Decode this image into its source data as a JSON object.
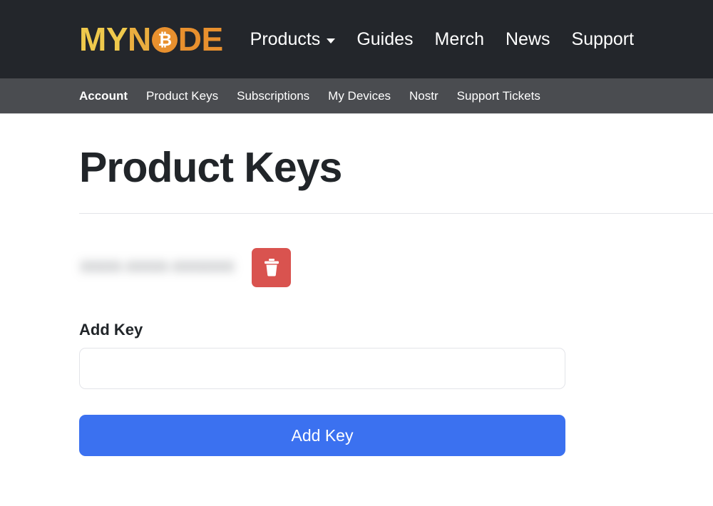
{
  "header": {
    "logo": {
      "part1": "MY",
      "part2": "N",
      "bitcoin_icon": "bitcoin-icon",
      "part3": "DE",
      "colors": {
        "yellow": "#efc94c",
        "amber": "#eaae3f",
        "orange": "#e8902e"
      }
    },
    "background": "#23262b",
    "nav_items": [
      {
        "label": "Products",
        "has_dropdown": true,
        "icon": "chevron-down-icon"
      },
      {
        "label": "Guides",
        "has_dropdown": false
      },
      {
        "label": "Merch",
        "has_dropdown": false
      },
      {
        "label": "News",
        "has_dropdown": false
      },
      {
        "label": "Support",
        "has_dropdown": false
      }
    ]
  },
  "subnav": {
    "background": "#4a4c50",
    "items": [
      {
        "label": "Account",
        "active": true
      },
      {
        "label": "Product Keys",
        "active": false
      },
      {
        "label": "Subscriptions",
        "active": false
      },
      {
        "label": "My Devices",
        "active": false
      },
      {
        "label": "Nostr",
        "active": false
      },
      {
        "label": "Support Tickets",
        "active": false
      }
    ]
  },
  "main": {
    "page_title": "Product Keys",
    "keys": [
      {
        "value": "XXXX-XXXX-XXXXXX",
        "redacted": true,
        "delete_icon": "trash-icon",
        "delete_color": "#d9534f"
      }
    ],
    "add_key_form": {
      "label": "Add Key",
      "input_value": "",
      "input_placeholder": "",
      "submit_label": "Add Key",
      "submit_color": "#3b71f0"
    }
  }
}
